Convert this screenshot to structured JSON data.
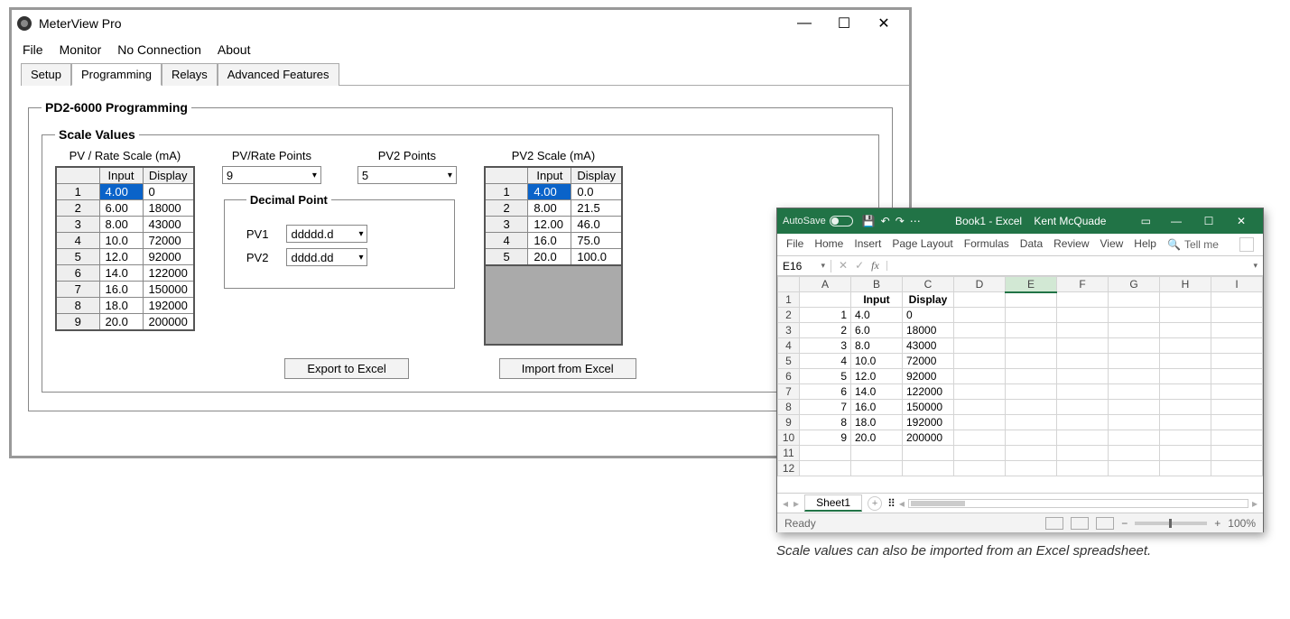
{
  "mv": {
    "title": "MeterView Pro",
    "menus": [
      "File",
      "Monitor",
      "No Connection",
      "About"
    ],
    "tabs": [
      "Setup",
      "Programming",
      "Relays",
      "Advanced Features"
    ],
    "active_tab": 1,
    "group_title": "PD2-6000 Programming",
    "scale_title": "Scale Values",
    "headers": {
      "pv_rate": "PV / Rate Scale (mA)",
      "pv_rate_points": "PV/Rate Points",
      "pv2_points": "PV2 Points",
      "pv2_scale": "PV2 Scale (mA)"
    },
    "table_cols": [
      "Input",
      "Display"
    ],
    "pv_rate_table": [
      {
        "n": "1",
        "input": "4.00",
        "display": "0"
      },
      {
        "n": "2",
        "input": "6.00",
        "display": "18000"
      },
      {
        "n": "3",
        "input": "8.00",
        "display": "43000"
      },
      {
        "n": "4",
        "input": "10.0",
        "display": "72000"
      },
      {
        "n": "5",
        "input": "12.0",
        "display": "92000"
      },
      {
        "n": "6",
        "input": "14.0",
        "display": "122000"
      },
      {
        "n": "7",
        "input": "16.0",
        "display": "150000"
      },
      {
        "n": "8",
        "input": "18.0",
        "display": "192000"
      },
      {
        "n": "9",
        "input": "20.0",
        "display": "200000"
      }
    ],
    "pv2_table": [
      {
        "n": "1",
        "input": "4.00",
        "display": "0.0"
      },
      {
        "n": "2",
        "input": "8.00",
        "display": "21.5"
      },
      {
        "n": "3",
        "input": "12.00",
        "display": "46.0"
      },
      {
        "n": "4",
        "input": "16.0",
        "display": "75.0"
      },
      {
        "n": "5",
        "input": "20.0",
        "display": "100.0"
      }
    ],
    "pv_rate_points_value": "9",
    "pv2_points_value": "5",
    "decimal_title": "Decimal Point",
    "decimal": {
      "pv1_label": "PV1",
      "pv1_value": "ddddd.d",
      "pv2_label": "PV2",
      "pv2_value": "dddd.dd"
    },
    "buttons": {
      "export": "Export to Excel",
      "import": "Import from Excel"
    }
  },
  "excel": {
    "autosave_label": "AutoSave",
    "title_doc": "Book1 - Excel",
    "title_user": "Kent McQuade",
    "ribbon_tabs": [
      "File",
      "Home",
      "Insert",
      "Page Layout",
      "Formulas",
      "Data",
      "Review",
      "View",
      "Help"
    ],
    "tell_me": "Tell me",
    "namebox": "E16",
    "fx_label": "fx",
    "columns": [
      "A",
      "B",
      "C",
      "D",
      "E",
      "F",
      "G",
      "H",
      "I"
    ],
    "selected_col_index": 4,
    "data": {
      "headers": {
        "b": "Input",
        "c": "Display"
      },
      "rows": [
        {
          "r": "1",
          "a": "",
          "b": "Input",
          "c": "Display"
        },
        {
          "r": "2",
          "a": "1",
          "b": "4.0",
          "c": "0"
        },
        {
          "r": "3",
          "a": "2",
          "b": "6.0",
          "c": "18000"
        },
        {
          "r": "4",
          "a": "3",
          "b": "8.0",
          "c": "43000"
        },
        {
          "r": "5",
          "a": "4",
          "b": "10.0",
          "c": "72000"
        },
        {
          "r": "6",
          "a": "5",
          "b": "12.0",
          "c": "92000"
        },
        {
          "r": "7",
          "a": "6",
          "b": "14.0",
          "c": "122000"
        },
        {
          "r": "8",
          "a": "7",
          "b": "16.0",
          "c": "150000"
        },
        {
          "r": "9",
          "a": "8",
          "b": "18.0",
          "c": "192000"
        },
        {
          "r": "10",
          "a": "9",
          "b": "20.0",
          "c": "200000"
        },
        {
          "r": "11",
          "a": "",
          "b": "",
          "c": ""
        },
        {
          "r": "12",
          "a": "",
          "b": "",
          "c": ""
        }
      ]
    },
    "sheet_name": "Sheet1",
    "status": "Ready",
    "zoom": "100%"
  },
  "caption": "Scale values can also be imported from an Excel spreadsheet."
}
